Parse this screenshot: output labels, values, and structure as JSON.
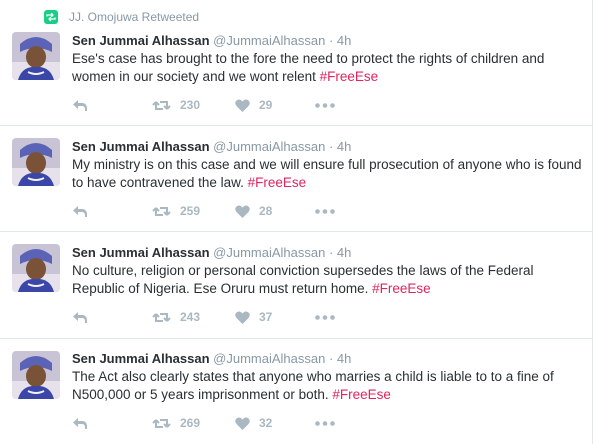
{
  "colors": {
    "hashtag": "#e0245e",
    "meta": "#8899a6",
    "action": "#aab8c2",
    "text": "#292f33"
  },
  "retweet_context": {
    "label": "JJ. Omojuwa Retweeted",
    "icon": "retweet-badge-icon"
  },
  "tweets": [
    {
      "name": "Sen Jummai Alhassan",
      "handle": "@JummaiAlhassan",
      "dot": "·",
      "time": "4h",
      "text": "Ese's case has brought to the fore the need to protect the rights of children and women in our society and we wont relent",
      "hashtag": "#FreeEse",
      "retweets": "230",
      "likes": "29"
    },
    {
      "name": "Sen Jummai Alhassan",
      "handle": "@JummaiAlhassan",
      "dot": "·",
      "time": "4h",
      "text": "My ministry is on this case and we will ensure full prosecution of anyone who is found to have contravened the law.",
      "hashtag": "#FreeEse",
      "retweets": "259",
      "likes": "28"
    },
    {
      "name": "Sen Jummai Alhassan",
      "handle": "@JummaiAlhassan",
      "dot": "·",
      "time": "4h",
      "text": "No culture, religion or personal conviction supersedes the laws of the Federal Republic of Nigeria. Ese Oruru must return home.",
      "hashtag": "#FreeEse",
      "retweets": "243",
      "likes": "37"
    },
    {
      "name": "Sen Jummai Alhassan",
      "handle": "@JummaiAlhassan",
      "dot": "·",
      "time": "4h",
      "text": "The Act also clearly states that anyone who marries a child is liable to to a fine of N500,000 or 5 years imprisonment or both.",
      "hashtag": "#FreeEse",
      "retweets": "269",
      "likes": "32"
    }
  ]
}
